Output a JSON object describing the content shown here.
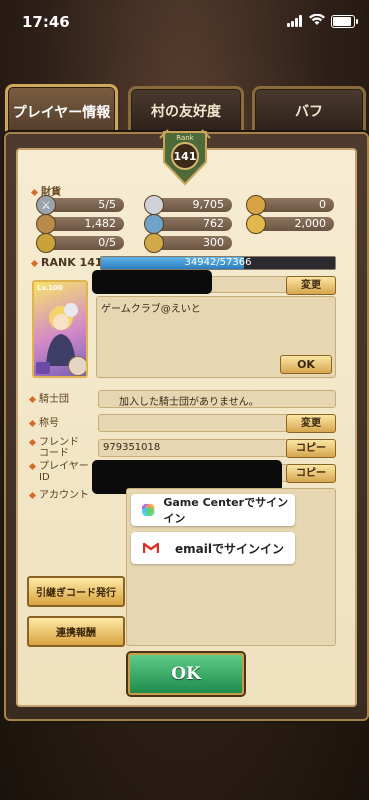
{
  "status_bar": {
    "time": "17:46"
  },
  "tabs": [
    {
      "label": "プレイヤー情報",
      "active": true
    },
    {
      "label": "村の友好度",
      "active": false
    },
    {
      "label": "バフ",
      "active": false
    }
  ],
  "rank_emblem": {
    "caption": "Rank",
    "value": "141"
  },
  "resources": {
    "title": "財貨",
    "items": [
      {
        "icon": "sword-icon",
        "value": "5/5"
      },
      {
        "icon": "silver-coin-icon",
        "value": "9,705"
      },
      {
        "icon": "gold-medal-icon",
        "value": "0"
      },
      {
        "icon": "tickets-icon",
        "value": "1,482"
      },
      {
        "icon": "blue-gem-icon",
        "value": "762"
      },
      {
        "icon": "gold-coin-icon",
        "value": "2,000"
      },
      {
        "icon": "orb-icon",
        "value": "0/5"
      },
      {
        "icon": "token-icon",
        "value": "300"
      }
    ]
  },
  "rank": {
    "label": "RANK 141",
    "exp_text": "34942/57366",
    "exp_fraction": 0.609
  },
  "avatar": {
    "level": "Lv.100"
  },
  "profile": {
    "name_change_label": "変更",
    "comment": "ゲームクラブ@えいと",
    "comment_ok_label": "OK"
  },
  "knights": {
    "label": "騎士団",
    "value": "加入した騎士団がありません。"
  },
  "title_row": {
    "label": "称号",
    "button": "変更"
  },
  "friend_code": {
    "label_line1": "フレンド",
    "label_line2": "コード",
    "value": "979351018",
    "button": "コピー"
  },
  "player_id": {
    "label_line1": "プレイヤー",
    "label_line2": "ID",
    "button": "コピー"
  },
  "account": {
    "label": "アカウント",
    "game_center": "Game Centerでサインイン",
    "email": "emailでサインイン"
  },
  "buttons": {
    "transfer_code": "引継ぎコード発行",
    "link_reward": "連携報酬",
    "ok": "OK"
  }
}
